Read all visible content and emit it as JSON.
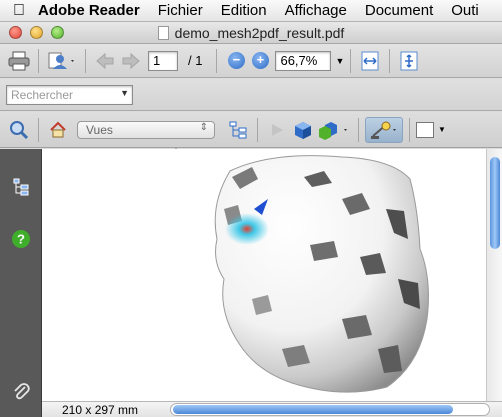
{
  "menubar": {
    "app_name": "Adobe Reader",
    "items": [
      "Fichier",
      "Edition",
      "Affichage",
      "Document",
      "Outi"
    ]
  },
  "window": {
    "title": "demo_mesh2pdf_result.pdf"
  },
  "toolbar": {
    "page_current": "1",
    "page_total": "/ 1",
    "zoom": "66,7%"
  },
  "search": {
    "placeholder": "Rechercher"
  },
  "toolbar_3d": {
    "views_label": "Vues"
  },
  "status": {
    "page_size": "210 x 297 mm"
  },
  "colors": {
    "accent": "#2e6cc8",
    "nav_panel": "#595959",
    "help_green": "#3fae2a"
  }
}
